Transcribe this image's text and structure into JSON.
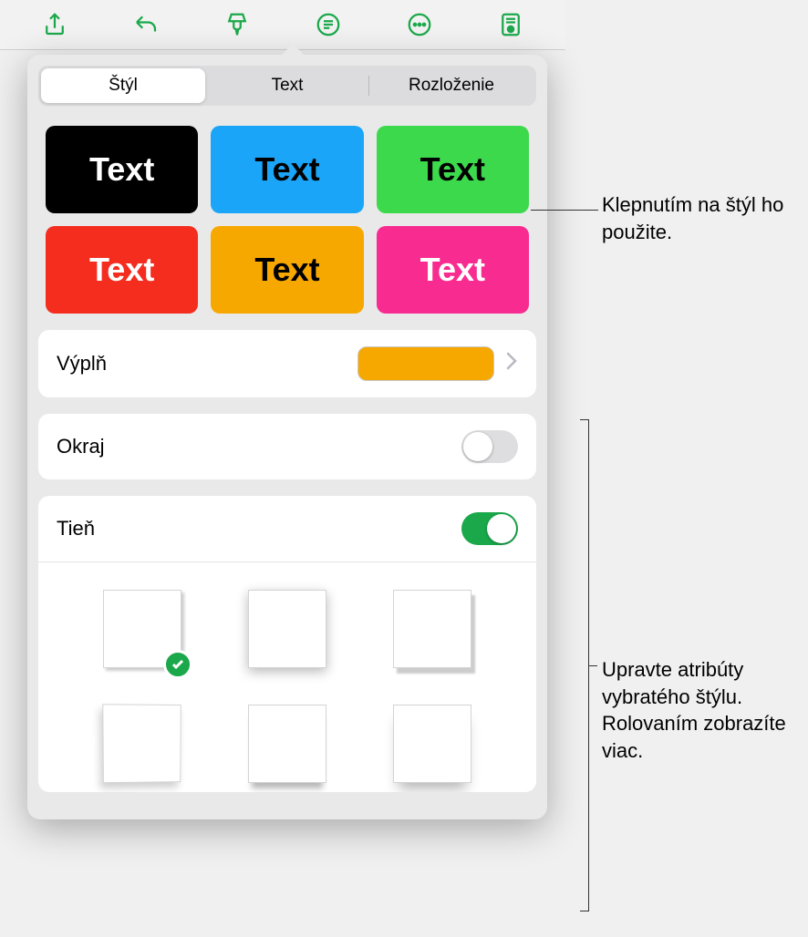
{
  "toolbar": {
    "icons": [
      "share-icon",
      "undo-icon",
      "format-brush-icon",
      "comment-icon",
      "more-icon",
      "reader-icon"
    ]
  },
  "tabs": {
    "items": [
      {
        "label": "Štýl",
        "active": true
      },
      {
        "label": "Text",
        "active": false
      },
      {
        "label": "Rozloženie",
        "active": false
      }
    ]
  },
  "style_swatches": {
    "label": "Text",
    "items": [
      {
        "color": "black"
      },
      {
        "color": "blue"
      },
      {
        "color": "green"
      },
      {
        "color": "red"
      },
      {
        "color": "orange"
      },
      {
        "color": "pink"
      }
    ]
  },
  "fill": {
    "label": "Výplň",
    "color": "#f7a800"
  },
  "border": {
    "label": "Okraj",
    "enabled": false
  },
  "shadow": {
    "label": "Tieň",
    "enabled": true,
    "selected_index": 0,
    "options": [
      "sh1",
      "sh2",
      "sh3",
      "sh4",
      "sh5",
      "sh6"
    ]
  },
  "callouts": {
    "apply_style": "Klepnutím na štýl ho použite.",
    "edit_attributes": "Upravte atribúty vybratého štýlu. Rolovaním zobrazíte viac."
  }
}
